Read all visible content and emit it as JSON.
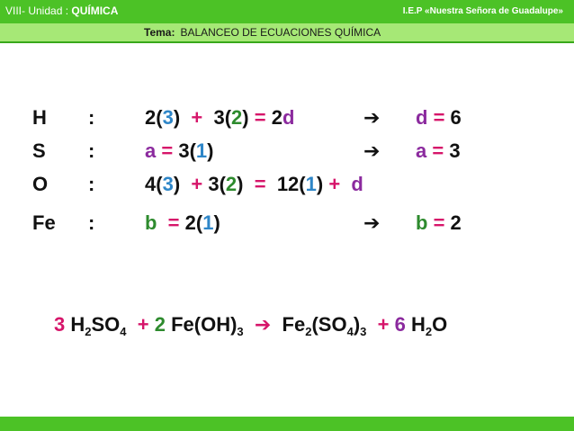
{
  "header": {
    "unit_prefix": "VIII- Unidad :",
    "unit_name": "QUÍMICA",
    "school": "I.E.P «Nuestra Señora de Guadalupe»",
    "tema_label": "Tema:",
    "tema_text": "BALANCEO  DE  ECUACIONES  QUÍMICA"
  },
  "rows": [
    {
      "element": "H",
      "colon": ":",
      "eq": {
        "p1": "2(",
        "n1": "3",
        "p2": ")  ",
        "op1": "+",
        "p3": "  3(",
        "n2": "2",
        "p4": ") ",
        "op2": "=",
        "p5": " 2",
        "var": "d"
      },
      "arrow": "➔",
      "res": {
        "var": "d",
        "eq": " = ",
        "val": "6"
      }
    },
    {
      "element": "S",
      "colon": ":",
      "eq": {
        "var": "a",
        "op": " = ",
        "p1": "3(",
        "n1": "1",
        "p2": ")"
      },
      "arrow": "➔",
      "res": {
        "var": "a",
        "eq": " = ",
        "val": "3"
      }
    },
    {
      "element": "O",
      "colon": ":",
      "eq": {
        "p1": "4(",
        "n1": "3",
        "p2": ")  ",
        "op1": "+",
        "p3": " 3(",
        "n2": "2",
        "p4": ")  ",
        "op2": "=",
        "p5": "  12(",
        "n3": "1",
        "p6": ") ",
        "op3": "+",
        "p7": "  ",
        "var": "d"
      }
    },
    {
      "element": "Fe",
      "colon": ":",
      "eq": {
        "var": "b",
        "op": "  = ",
        "p1": "2(",
        "n1": "1",
        "p2": ")"
      },
      "arrow": "➔",
      "res": {
        "var": "b",
        "eq": " = ",
        "val": "2"
      }
    }
  ],
  "final_equation": {
    "coef1": "3",
    "h2so4": [
      "H",
      "2",
      "SO",
      "4"
    ],
    "plus1": "  + ",
    "coef2": "2",
    "feoh3": [
      " Fe(OH)",
      "3"
    ],
    "arrow": "  ➔  ",
    "fe2so43": [
      "Fe",
      "2",
      "(SO",
      "4",
      ")",
      "3"
    ],
    "plus2": "  + ",
    "coef3": "6",
    "h2o": [
      " H",
      "2",
      "O"
    ]
  },
  "colors": {
    "bar_green": "#4CC226",
    "subbar_green": "#A6E876",
    "purple": "#8B2A9E",
    "blue": "#2E86C8",
    "green": "#2E8B2E",
    "magenta": "#D6156A"
  }
}
